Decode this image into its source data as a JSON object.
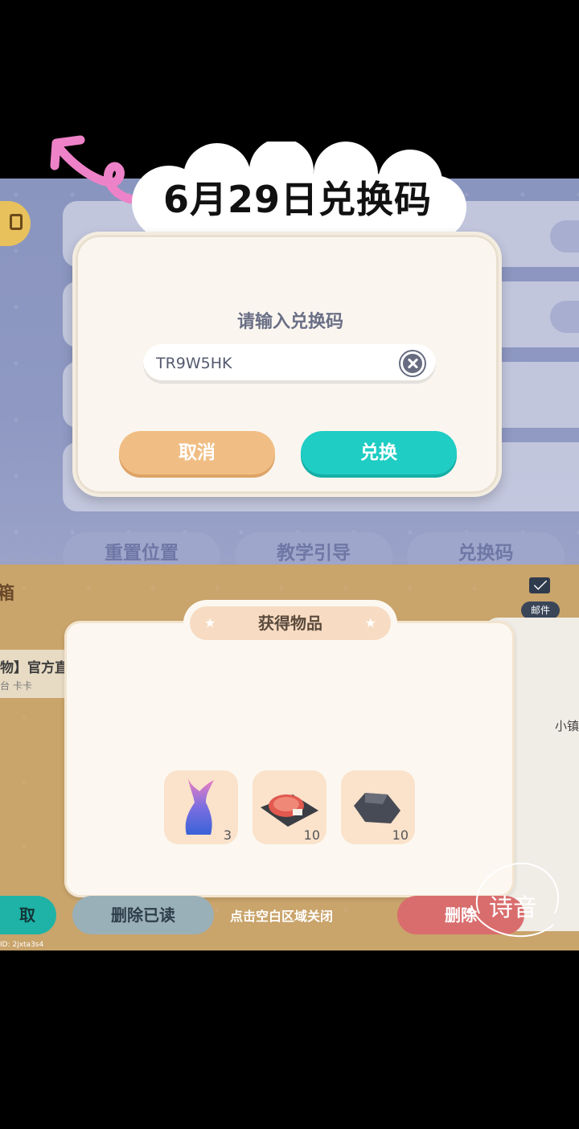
{
  "header": {
    "title": "6月29日兑换码"
  },
  "settings_bg": {
    "tabs": [
      "重置位置",
      "教学引导",
      "兑换码"
    ]
  },
  "redeem_dialog": {
    "prompt": "请输入兑换码",
    "code_value": "TR9W5HK",
    "cancel_label": "取消",
    "redeem_label": "兑换"
  },
  "mailbox": {
    "heading": "箱",
    "mail_label": "邮件",
    "item_title": "物】官方直",
    "item_sub": "台 卡卡",
    "side_text": "小镇",
    "reward_title": "获得物品",
    "rewards": [
      {
        "icon": "mermaid-tail-icon",
        "count": "3"
      },
      {
        "icon": "steak-icon",
        "count": "10"
      },
      {
        "icon": "stone-icon",
        "count": "10"
      }
    ],
    "get_label": "取",
    "delete_read_label": "删除已读",
    "close_hint": "点击空白区域关闭",
    "delete_label": "删除",
    "uid": "ID: 2jxta3s4"
  },
  "watermark": {
    "text": "诗音"
  },
  "colors": {
    "accent_teal": "#1fcdc4",
    "cancel_orange": "#f0be84",
    "arrow_pink": "#ee82c8"
  }
}
